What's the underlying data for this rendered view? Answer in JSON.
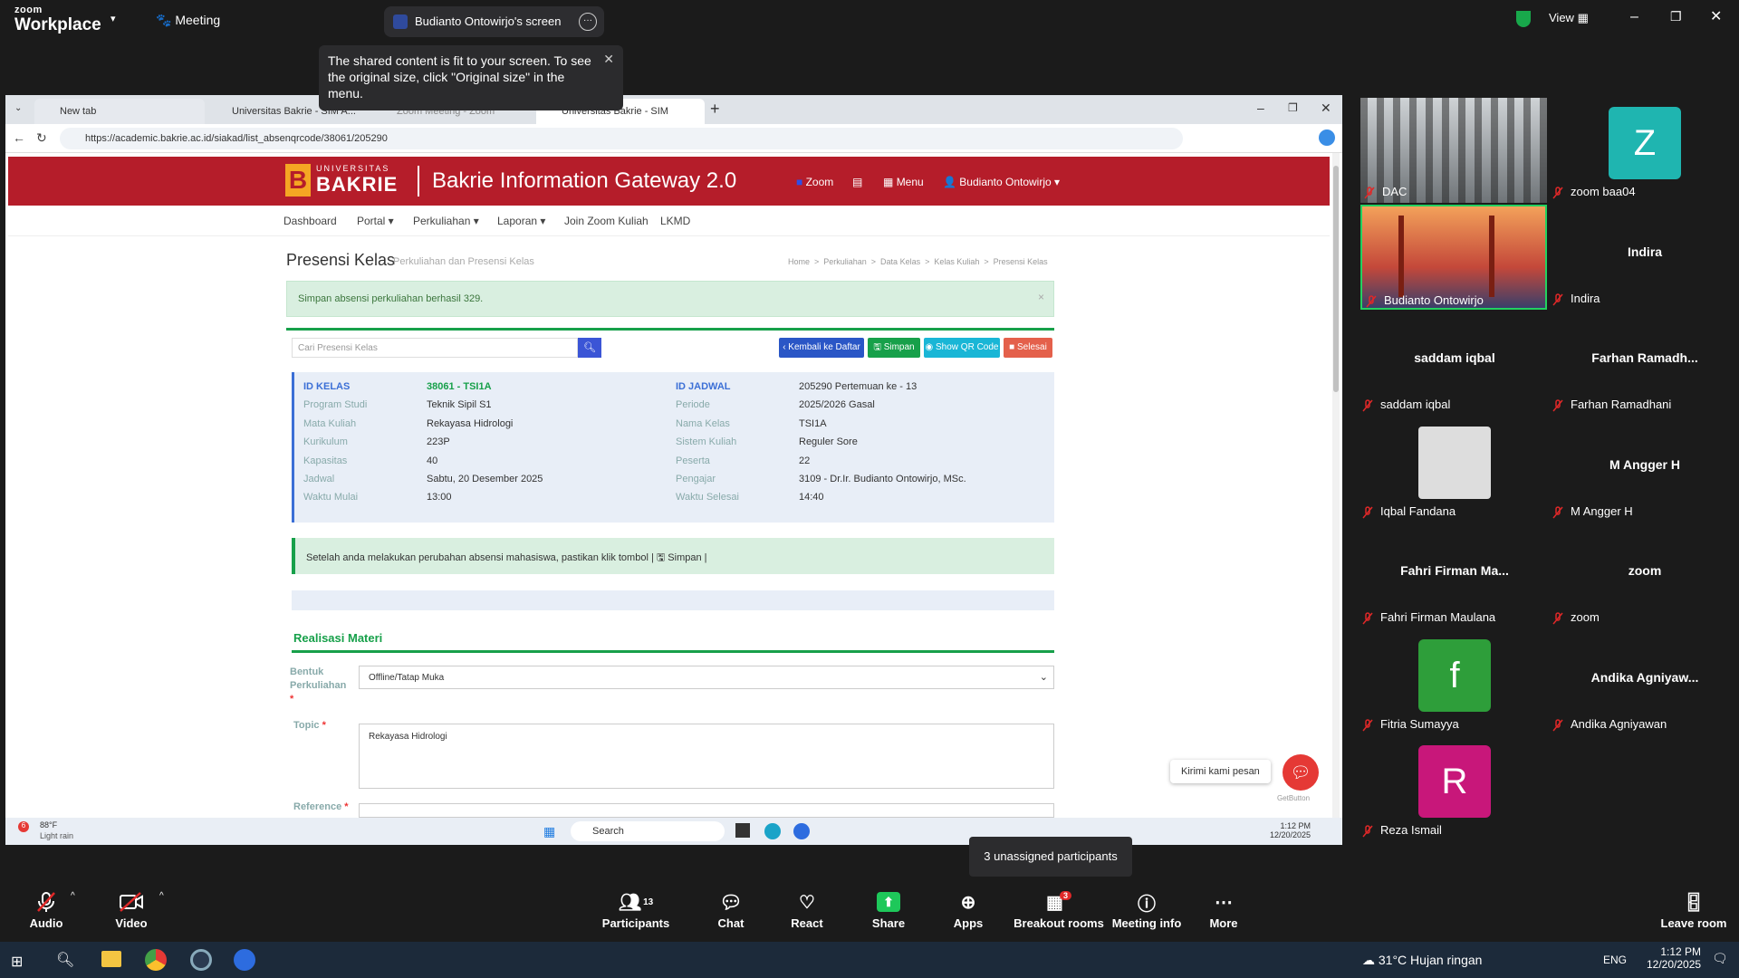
{
  "zoom": {
    "brand_small": "zoom",
    "brand": "Workplace",
    "meeting_label": "Meeting",
    "share_tab_title": "Budianto Ontowirjo's screen",
    "tooltip": "The shared content is fit to your screen. To see the original size, click \"Original size\" in the menu.",
    "view_label": "View",
    "unassigned": "3 unassigned participants",
    "participants_count": "13",
    "breakout_badge": "3",
    "bottom": {
      "audio": "Audio",
      "video": "Video",
      "participants": "Participants",
      "chat": "Chat",
      "react": "React",
      "share": "Share",
      "apps": "Apps",
      "breakout": "Breakout rooms",
      "info": "Meeting info",
      "more": "More",
      "leave": "Leave room"
    }
  },
  "browser": {
    "tabs": [
      "New tab",
      "Universitas Bakrie - SIM A...",
      "Zoom Meeting - Zoom",
      "Universitas Bakrie - SIM Akademik"
    ],
    "url": "https://academic.bakrie.ac.id/siakad/list_absenqrcode/38061/205290"
  },
  "site": {
    "logo_top": "UNIVERSITAS",
    "logo": "BAKRIE",
    "title": "Bakrie Information Gateway 2.0",
    "zoom": "Zoom",
    "menu": "Menu",
    "user": "Budianto Ontowirjo ▾",
    "nav": [
      "Dashboard",
      "Portal ▾",
      "Perkuliahan ▾",
      "Laporan ▾",
      "Join Zoom Kuliah",
      "LKMD"
    ],
    "page_title": "Presensi Kelas",
    "page_sub": "Perkuliahan dan Presensi Kelas",
    "crumbs": "Home  >  Perkuliahan  >  Data Kelas  >  Kelas Kuliah  >  Presensi Kelas",
    "alert": "Simpan absensi perkuliahan berhasil 329.",
    "search_placeholder": "Cari Presensi Kelas",
    "btn_back": "‹ Kembali ke Daftar",
    "btn_save": "Simpan",
    "btn_qr": "Show QR Code",
    "btn_done": "Selesai",
    "left_labels": [
      "ID KELAS",
      "Program Studi",
      "Mata Kuliah",
      "Kurikulum",
      "Kapasitas",
      "Jadwal",
      "Waktu Mulai"
    ],
    "left_values": [
      "38061 - TSI1A",
      "Teknik Sipil S1",
      "Rekayasa Hidrologi",
      "223P",
      "40",
      "Sabtu, 20 Desember 2025",
      "13:00"
    ],
    "right_labels": [
      "ID JADWAL",
      "Periode",
      "Nama Kelas",
      "Sistem Kuliah",
      "Peserta",
      "Pengajar",
      "Waktu Selesai"
    ],
    "right_values": [
      "205290 Pertemuan ke - 13",
      "2025/2026 Gasal",
      "TSI1A",
      "Reguler Sore",
      "22",
      "3109 - Dr.Ir. Budianto Ontowirjo, MSc.",
      "14:40"
    ],
    "notice": "Setelah anda melakukan perubahan absensi mahasiswa, pastikan klik tombol | 🖫 Simpan |",
    "section": "Realisasi Materi",
    "bentuk_label": "Bentuk Perkuliahan",
    "bentuk_value": "Offline/Tatap Muka",
    "topic_label": "Topic",
    "topic_value": "Rekayasa Hidrologi",
    "reference_label": "Reference",
    "chat_bubble": "Kirimi kami pesan",
    "getbutton": "GetButton"
  },
  "inner_taskbar": {
    "weather_temp": "88°F",
    "weather": "Light rain",
    "search": "Search",
    "time": "1:12 PM",
    "date": "12/20/2025"
  },
  "gallery": [
    {
      "label": "DAC",
      "kind": "video-room"
    },
    {
      "label": "zoom baa04",
      "avatar": "Z",
      "color": "#1fb5b0"
    },
    {
      "label": "Budianto Ontowirjo",
      "kind": "video-bridge"
    },
    {
      "label": "Indira",
      "display": "Indira"
    },
    {
      "label": "saddam iqbal",
      "display": "saddam iqbal"
    },
    {
      "label": "Farhan Ramadhani",
      "display": "Farhan Ramadh..."
    },
    {
      "label": "Iqbal Fandana",
      "kind": "photo"
    },
    {
      "label": "M Angger H",
      "display": "M Angger H"
    },
    {
      "label": "Fahri Firman Maulana",
      "display": "Fahri Firman Ma..."
    },
    {
      "label": "zoom",
      "display": "zoom"
    },
    {
      "label": "Fitria Sumayya",
      "avatar": "f",
      "color": "#2e9e3a"
    },
    {
      "label": "Andika Agniyawan",
      "display": "Andika Agniyaw..."
    },
    {
      "label": "Reza Ismail",
      "avatar": "R",
      "color": "#c8177a"
    }
  ],
  "win_taskbar": {
    "weather": "31°C  Hujan ringan",
    "lang": "ENG",
    "time": "1:12 PM",
    "date": "12/20/2025"
  }
}
